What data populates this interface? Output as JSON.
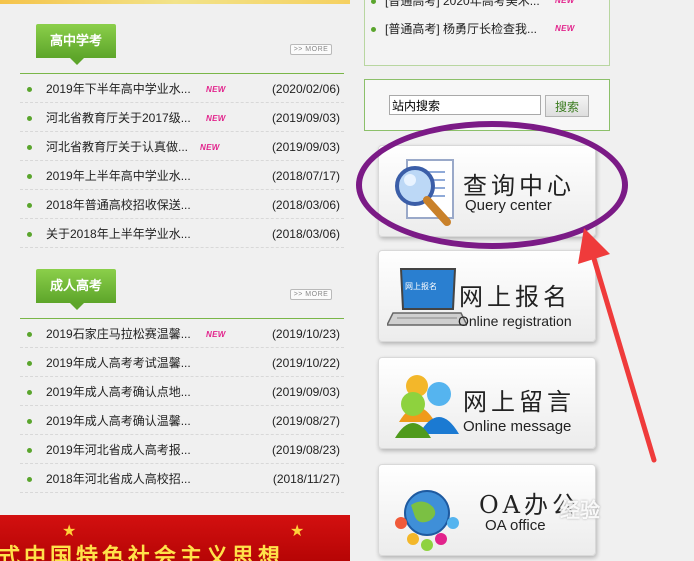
{
  "sections": [
    {
      "tab": "高中学考",
      "more": ">> MORE",
      "items": [
        {
          "title": "2019年下半年高中学业水...",
          "new": "NEW",
          "date": "(2020/02/06)"
        },
        {
          "title": "河北省教育厅关于2017级...",
          "new": "NEW",
          "date": "(2019/09/03)"
        },
        {
          "title": "河北省教育厅关于认真做...",
          "new": "NEW",
          "date": "(2019/09/03)"
        },
        {
          "title": "2019年上半年高中学业水...",
          "new": "",
          "date": "(2018/07/17)"
        },
        {
          "title": "2018年普通高校招收保送...",
          "new": "",
          "date": "(2018/03/06)"
        },
        {
          "title": "关于2018年上半年学业水...",
          "new": "",
          "date": "(2018/03/06)"
        }
      ]
    },
    {
      "tab": "成人高考",
      "more": ">> MORE",
      "items": [
        {
          "title": "2019石家庄马拉松赛温馨...",
          "new": "NEW",
          "date": "(2019/10/23)"
        },
        {
          "title": "2019年成人高考考试温馨...",
          "new": "",
          "date": "(2019/10/22)"
        },
        {
          "title": "2019年成人高考确认点地...",
          "new": "",
          "date": "(2019/09/03)"
        },
        {
          "title": "2019年成人高考确认温馨...",
          "new": "",
          "date": "(2019/08/27)"
        },
        {
          "title": "2019年河北省成人高考报...",
          "new": "",
          "date": "(2019/08/23)"
        },
        {
          "title": "2018年河北省成人高校招...",
          "new": "",
          "date": "(2018/11/27)"
        }
      ]
    }
  ],
  "right_news": [
    {
      "title": "[普通高考] 2020年高考美术...",
      "new": "NEW"
    },
    {
      "title": "[普通高考] 杨勇厅长检查我...",
      "new": "NEW"
    }
  ],
  "search": {
    "value": "站内搜索",
    "button": "搜索"
  },
  "cards": {
    "query": {
      "cn": "查询中心",
      "en": "Query center",
      "icon": "magnifier-document-icon"
    },
    "registration": {
      "cn": "网上报名",
      "en": "Online registration",
      "icon": "laptop-icon",
      "screen_text": "网上报名"
    },
    "message": {
      "cn": "网上留言",
      "en": "Online message",
      "icon": "people-icon"
    },
    "oa": {
      "cn": "OA办公",
      "en": "OA office",
      "icon": "globe-people-icon"
    }
  },
  "banner": {
    "text": "式中国特色社会主义思想"
  },
  "watermark": "经验",
  "colors": {
    "green": "#5da52a",
    "annotation_purple": "#7b1a86",
    "arrow_red": "#ef3b3b",
    "new_pink": "#e2238c"
  }
}
